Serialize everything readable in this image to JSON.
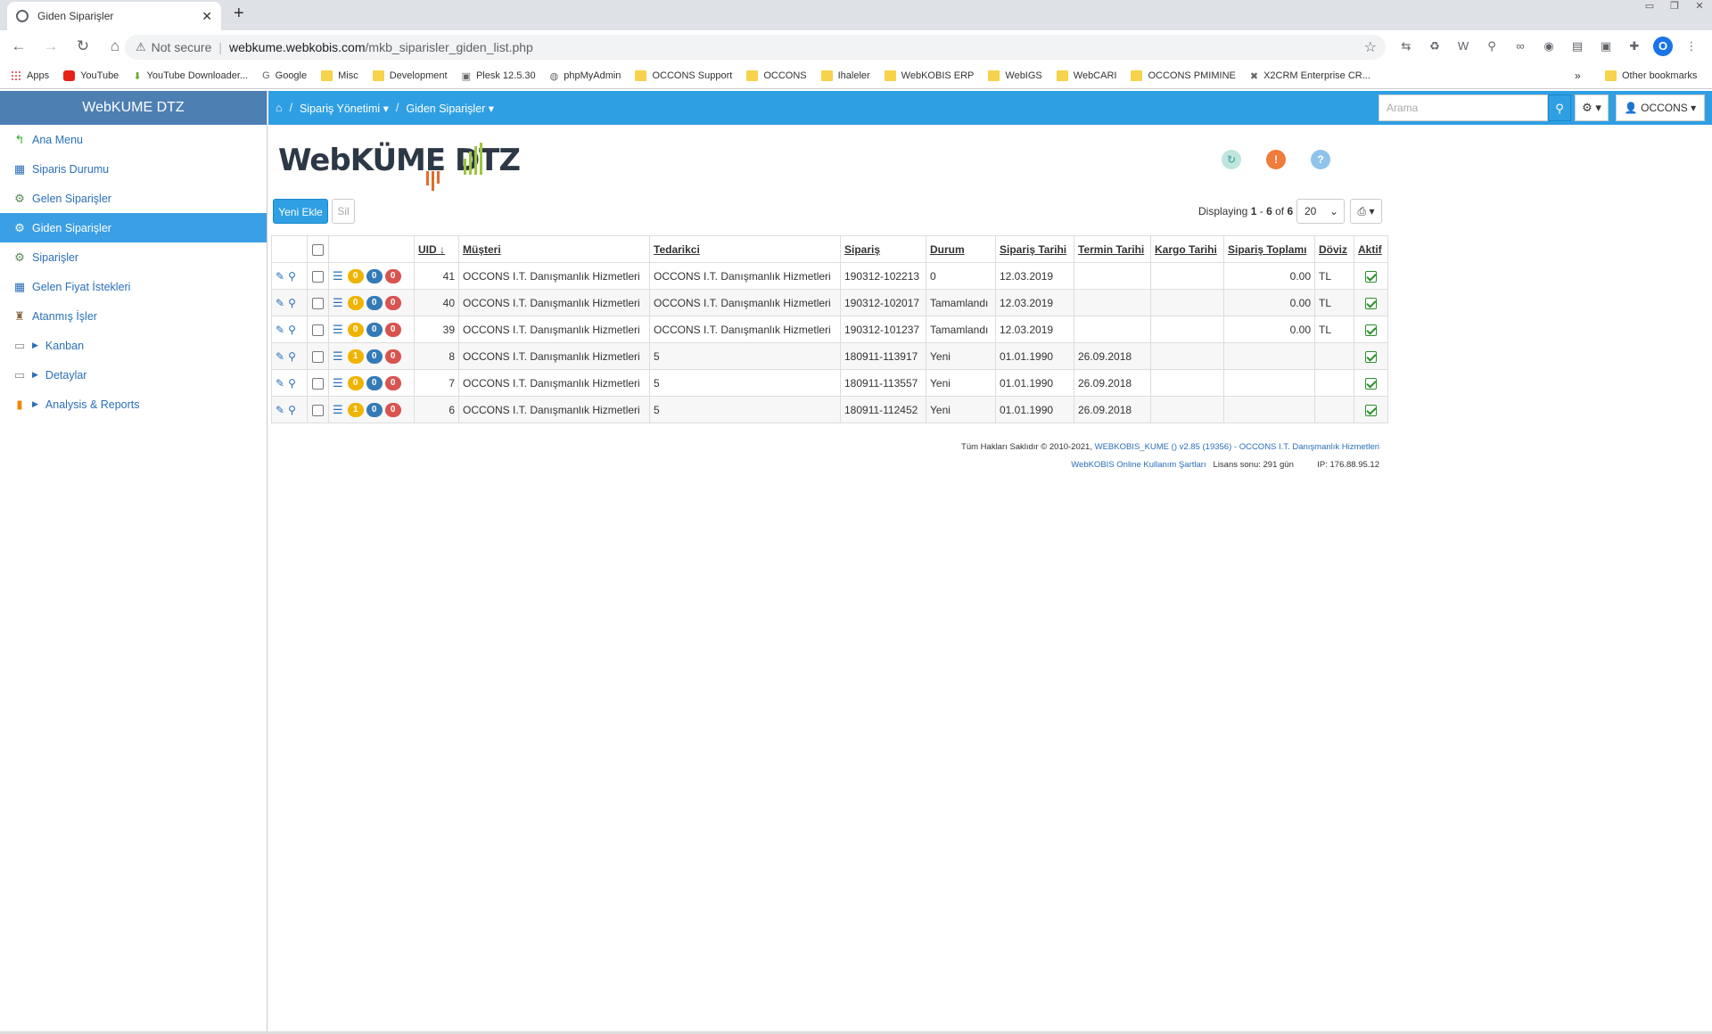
{
  "browser": {
    "tab_title": "Giden Siparişler",
    "address_warning": "Not secure",
    "address_host": "webkume.webkobis.com",
    "address_path": "/mkb_siparisler_giden_list.php",
    "bookmarks": [
      "Apps",
      "YouTube",
      "YouTube Downloader...",
      "Google",
      "Misc",
      "Development",
      "Plesk 12.5.30",
      "phpMyAdmin",
      "OCCONS Support",
      "OCCONS",
      "Ihaleler",
      "WebKOBIS ERP",
      "WebIGS",
      "WebCARI",
      "OCCONS PMIMINE",
      "X2CRM Enterprise CR..."
    ],
    "bookmarks_more": "»",
    "other_bookmarks": "Other bookmarks",
    "profile_initial": "O"
  },
  "sidebar": {
    "brand": "WebKUME DTZ",
    "items": [
      {
        "label": "Ana Menu",
        "icon": "↰"
      },
      {
        "label": "Siparis Durumu",
        "icon": "▦"
      },
      {
        "label": "Gelen Siparişler",
        "icon": "⚙"
      },
      {
        "label": "Giden Siparişler",
        "icon": "⚙"
      },
      {
        "label": "Siparişler",
        "icon": "⚙"
      },
      {
        "label": "Gelen Fiyat İstekleri",
        "icon": "▦"
      },
      {
        "label": "Atanmış İşler",
        "icon": "♜"
      },
      {
        "label": "Kanban",
        "icon": "▭"
      },
      {
        "label": "Detaylar",
        "icon": "▭"
      },
      {
        "label": "Analysis & Reports",
        "icon": "▮"
      }
    ]
  },
  "topnav": {
    "home_sep": "/",
    "crumb1": "Sipariş Yönetimi ▾",
    "crumb2": "Giden Siparişler ▾",
    "search_placeholder": "Arama",
    "user_label": "OCCONS ▾"
  },
  "logo": {
    "text": "WebKÜME DTZ"
  },
  "toolbar": {
    "add_label": "Yeni Ekle",
    "delete_label": "Sil",
    "displaying_prefix": "Displaying",
    "range_start": "1",
    "range_sep": "-",
    "range_end": "6",
    "of": "of",
    "total": "6",
    "page_size": "20"
  },
  "table": {
    "headers": [
      "UID ↓",
      "Müşteri",
      "Tedarikci",
      "Sipariş",
      "Durum",
      "Sipariş Tarihi",
      "Termin Tarihi",
      "Kargo Tarihi",
      "Sipariş Toplamı",
      "Döviz",
      "Aktif"
    ],
    "rows": [
      {
        "b1": "0",
        "b2": "0",
        "b3": "0",
        "uid": "41",
        "musteri": "OCCONS I.T. Danışmanlık Hizmetleri",
        "tedarikci": "OCCONS I.T. Danışmanlık Hizmetleri",
        "siparis": "190312-102213",
        "durum": "0",
        "siparis_tarihi": "12.03.2019",
        "termin": "",
        "kargo": "",
        "toplam": "0.00",
        "doviz": "TL"
      },
      {
        "b1": "0",
        "b2": "0",
        "b3": "0",
        "uid": "40",
        "musteri": "OCCONS I.T. Danışmanlık Hizmetleri",
        "tedarikci": "OCCONS I.T. Danışmanlık Hizmetleri",
        "siparis": "190312-102017",
        "durum": "Tamamlandı",
        "siparis_tarihi": "12.03.2019",
        "termin": "",
        "kargo": "",
        "toplam": "0.00",
        "doviz": "TL"
      },
      {
        "b1": "0",
        "b2": "0",
        "b3": "0",
        "uid": "39",
        "musteri": "OCCONS I.T. Danışmanlık Hizmetleri",
        "tedarikci": "OCCONS I.T. Danışmanlık Hizmetleri",
        "siparis": "190312-101237",
        "durum": "Tamamlandı",
        "siparis_tarihi": "12.03.2019",
        "termin": "",
        "kargo": "",
        "toplam": "0.00",
        "doviz": "TL"
      },
      {
        "b1": "1",
        "b2": "0",
        "b3": "0",
        "uid": "8",
        "musteri": "OCCONS I.T. Danışmanlık Hizmetleri",
        "tedarikci": "5",
        "siparis": "180911-113917",
        "durum": "Yeni",
        "siparis_tarihi": "01.01.1990",
        "termin": "26.09.2018",
        "kargo": "",
        "toplam": "",
        "doviz": ""
      },
      {
        "b1": "0",
        "b2": "0",
        "b3": "0",
        "uid": "7",
        "musteri": "OCCONS I.T. Danışmanlık Hizmetleri",
        "tedarikci": "5",
        "siparis": "180911-113557",
        "durum": "Yeni",
        "siparis_tarihi": "01.01.1990",
        "termin": "26.09.2018",
        "kargo": "",
        "toplam": "",
        "doviz": ""
      },
      {
        "b1": "1",
        "b2": "0",
        "b3": "0",
        "uid": "6",
        "musteri": "OCCONS I.T. Danışmanlık Hizmetleri",
        "tedarikci": "5",
        "siparis": "180911-112452",
        "durum": "Yeni",
        "siparis_tarihi": "01.01.1990",
        "termin": "26.09.2018",
        "kargo": "",
        "toplam": "",
        "doviz": ""
      }
    ]
  },
  "footer": {
    "copyright": "Tüm Hakları Saklıdır © 2010-2021,",
    "version_link": "WEBKOBIS_KUME () v2.85 (19356) - OCCONS I.T. Danışmanlık Hizmetleri",
    "terms_link": "WebKOBIS Online Kullanım Şartları",
    "license": "Lisans sonu: 291 gün",
    "ip": "IP: 176.88.95.12"
  },
  "colors": {
    "topnav": "#2f9fe3",
    "brand": "#4d7fb3",
    "active": "#3a9fe4"
  }
}
